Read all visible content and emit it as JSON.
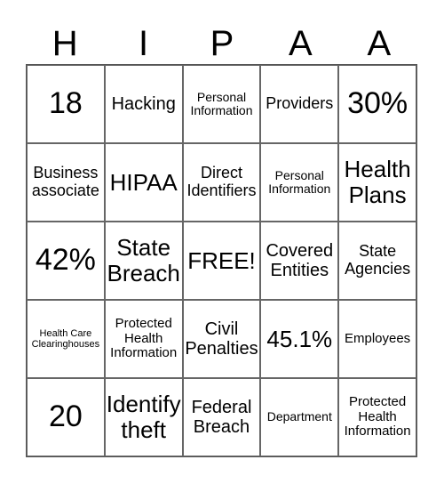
{
  "header": {
    "letters": [
      "H",
      "I",
      "P",
      "A",
      "A"
    ]
  },
  "cells": [
    {
      "text": "18",
      "size": "s-xl"
    },
    {
      "text": "Hacking",
      "size": "s-m"
    },
    {
      "text": "Personal Information",
      "size": "s-xs"
    },
    {
      "text": "Providers",
      "size": "s-ms"
    },
    {
      "text": "30%",
      "size": "s-xl"
    },
    {
      "text": "Business associate",
      "size": "s-ms"
    },
    {
      "text": "HIPAA",
      "size": "s-l"
    },
    {
      "text": "Direct Identifiers",
      "size": "s-ms"
    },
    {
      "text": "Personal Information",
      "size": "s-xs"
    },
    {
      "text": "Health Plans",
      "size": "s-l"
    },
    {
      "text": "42%",
      "size": "s-xl"
    },
    {
      "text": "State Breach",
      "size": "s-l"
    },
    {
      "text": "FREE!",
      "size": "s-l"
    },
    {
      "text": "Covered Entities",
      "size": "s-m"
    },
    {
      "text": "State Agencies",
      "size": "s-ms"
    },
    {
      "text": "Health Care Clearinghouses",
      "size": "s-xxs"
    },
    {
      "text": "Protected Health Information",
      "size": "s-s"
    },
    {
      "text": "Civil Penalties",
      "size": "s-m"
    },
    {
      "text": "45.1%",
      "size": "s-l"
    },
    {
      "text": "Employees",
      "size": "s-s"
    },
    {
      "text": "20",
      "size": "s-xl"
    },
    {
      "text": "Identify theft",
      "size": "s-l"
    },
    {
      "text": "Federal Breach",
      "size": "s-m"
    },
    {
      "text": "Department",
      "size": "s-xs"
    },
    {
      "text": "Protected Health Information",
      "size": "s-s"
    }
  ]
}
